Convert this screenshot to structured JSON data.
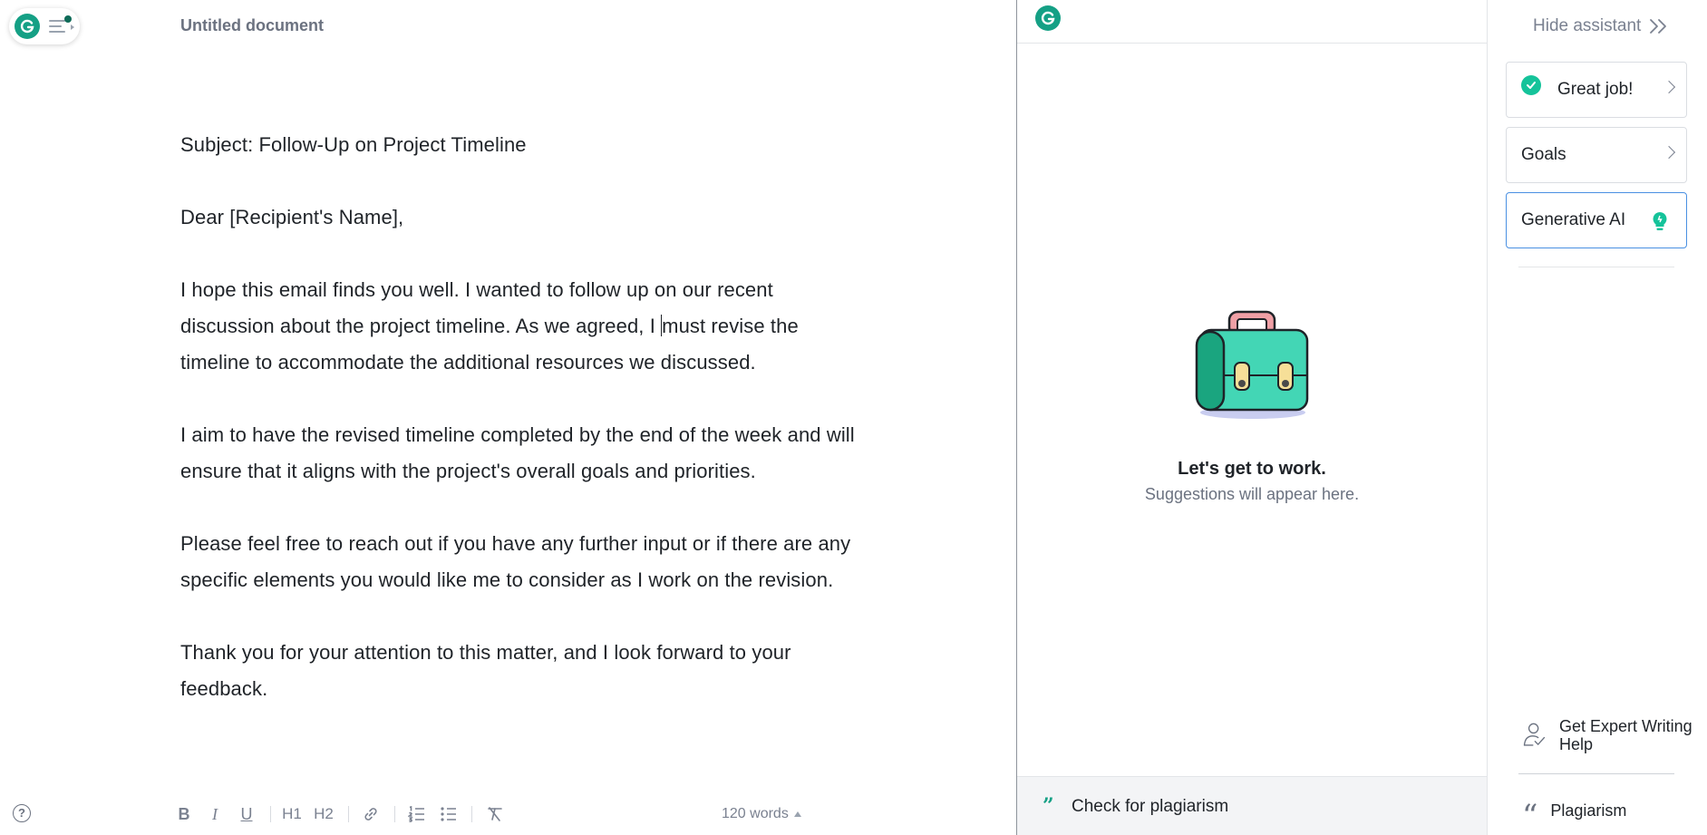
{
  "editor": {
    "title": "Untitled document",
    "paragraphs": {
      "subject": "Subject: Follow-Up on Project Timeline",
      "greeting": "Dear [Recipient's Name],",
      "p1_before_caret": "I hope this email finds you well. I wanted to follow up on our recent discussion about the project timeline. As we agreed, I ",
      "p1_after_caret": "must revise the timeline to accommodate the additional resources we discussed.",
      "p2": "I aim to have the revised timeline completed by the end of the week and will ensure that it aligns with the project's overall goals and priorities.",
      "p3": "Please feel free to reach out if you have any further input or if there are any specific elements you would like me to consider as I work on the revision.",
      "p4": "Thank you for your attention to this matter, and I look forward to your feedback."
    },
    "toolbar": {
      "help": "?",
      "bold": "B",
      "italic": "I",
      "underline": "U",
      "h1": "H1",
      "h2": "H2",
      "word_count": "120 words"
    }
  },
  "assistant": {
    "empty_title": "Let's get to work.",
    "empty_subtitle": "Suggestions will appear here.",
    "plagiarism_check": "Check for plagiarism"
  },
  "sidebar": {
    "hide_label": "Hide assistant",
    "cards": {
      "great_job": "Great job!",
      "goals": "Goals",
      "generative_ai": "Generative AI"
    },
    "expert_help": "Get Expert Writing Help",
    "plagiarism": "Plagiarism"
  },
  "colors": {
    "brand_green": "#15a085",
    "check_green": "#15c39a",
    "ai_border": "#4a90e2"
  }
}
